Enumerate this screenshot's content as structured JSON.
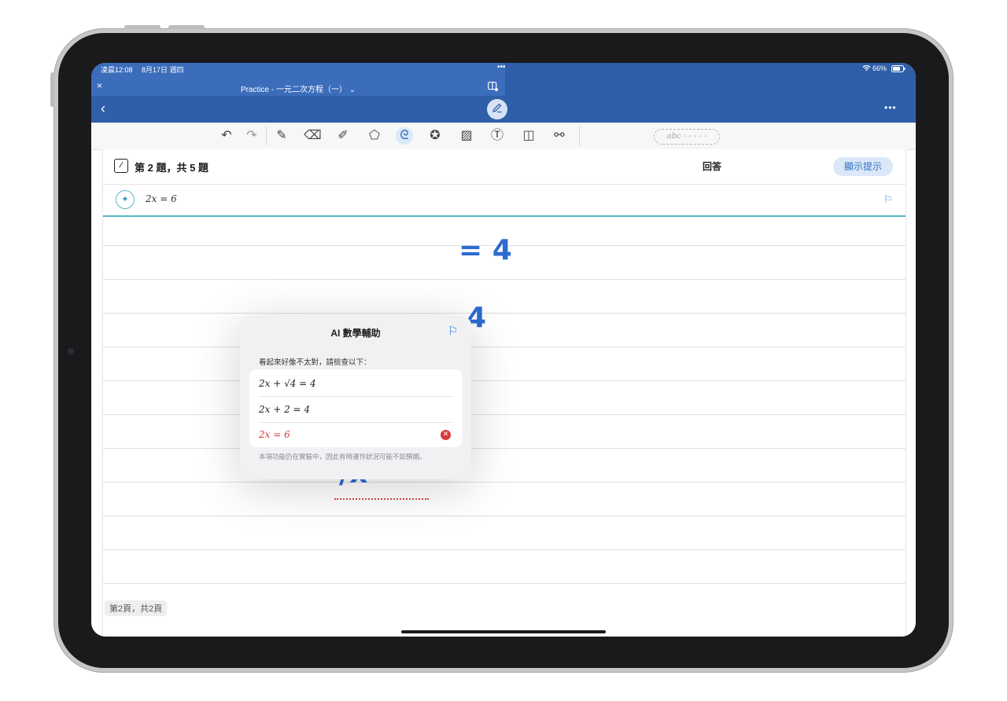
{
  "status_bar": {
    "time": "凌晨12:08",
    "date": "8月17日 週四",
    "dots": "•••",
    "battery": "66%"
  },
  "window": {
    "title": "Practice - 一元二次方程（一）",
    "title_chevron": "⌄",
    "close": "×",
    "more": "•••",
    "back": "‹"
  },
  "toolbar": {
    "text_field_placeholder": "abc - - - - -"
  },
  "question": {
    "title": "第 2 題，共 5 題",
    "answer_label": "回答",
    "hint_button": "顯示提示",
    "equation": "2x = 6"
  },
  "handwriting": {
    "line1": "= 4",
    "line2": "4",
    "line3": "/x"
  },
  "popup": {
    "title": "AI 數學輔助",
    "message": "看起來好像不太對，請檢查以下：",
    "steps": [
      {
        "text": "2x + √4 = 4",
        "error": false
      },
      {
        "text": "2x + 2 = 4",
        "error": false
      },
      {
        "text": "2x = 6",
        "error": true
      }
    ],
    "note": "本項功能仍在實驗中，因此有時運作狀況可能不如預期。"
  },
  "page_indicator": "第2頁，共2頁",
  "icons": [
    "close-icon",
    "sidebar-icon",
    "back-icon",
    "pen-mode-icon",
    "more-icon",
    "undo-icon",
    "redo-icon",
    "pen-icon",
    "eraser-icon",
    "highlighter-icon",
    "shapes-icon",
    "lasso-icon",
    "sticker-icon",
    "image-icon",
    "textbox-icon",
    "photo-scan-icon",
    "link-icon",
    "flag-icon",
    "sparkle-icon",
    "error-icon",
    "wifi-icon",
    "battery-icon"
  ],
  "colors": {
    "header_blue": "#2f5fa8",
    "accent": "#2f6fc4",
    "error": "#d63a3a",
    "teal_rule": "#55b8c4",
    "ink": "#2d6bd0"
  }
}
